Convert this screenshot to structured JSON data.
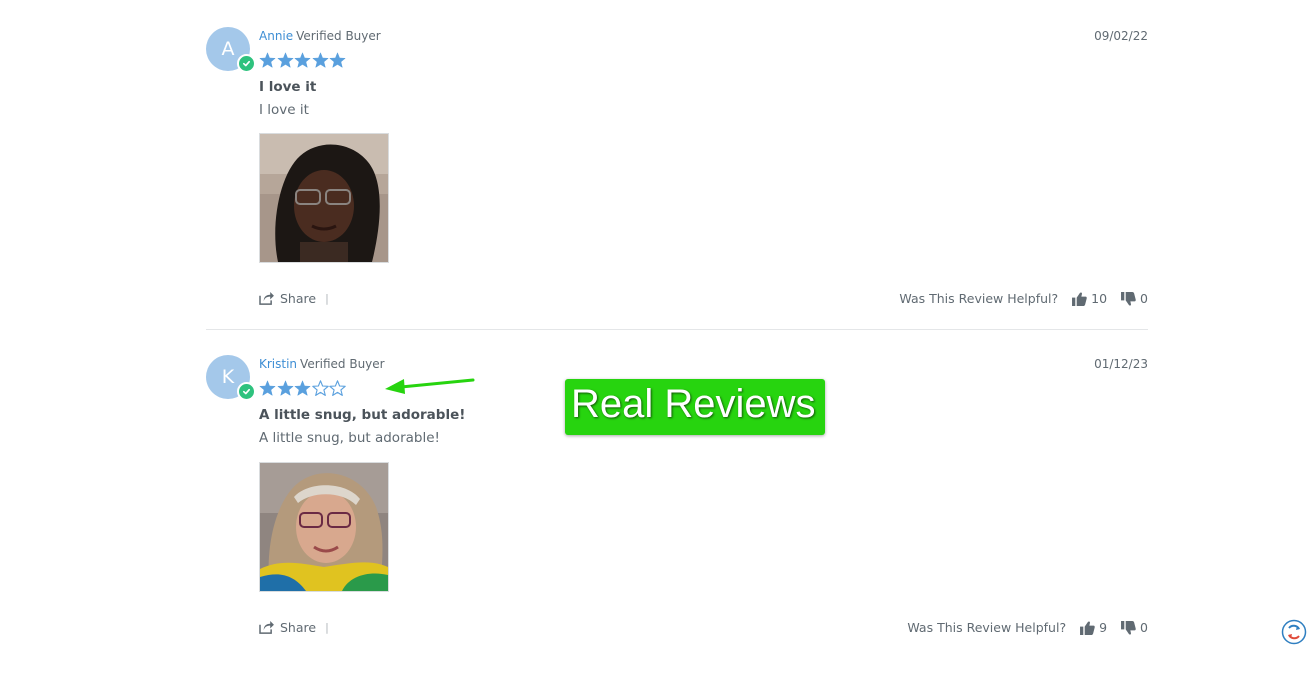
{
  "colors": {
    "star": "#5aa0de",
    "name": "#3e8ed4",
    "avatar_bg": "#a4c8ea",
    "verified_badge": "#2ec27e",
    "callout_bg": "#27d40f",
    "arrow": "#27d40f"
  },
  "reviews": [
    {
      "avatar_letter": "A",
      "name": "Annie",
      "verified_label": "Verified Buyer",
      "date": "09/02/22",
      "rating": 5,
      "max_rating": 5,
      "title": "I love it",
      "body": "I love it",
      "share_label": "Share",
      "share_separator": "|",
      "helpful_label": "Was This Review Helpful?",
      "thumbs_up_count": "10",
      "thumbs_down_count": "0"
    },
    {
      "avatar_letter": "K",
      "name": "Kristin",
      "verified_label": "Verified Buyer",
      "date": "01/12/23",
      "rating": 3,
      "max_rating": 5,
      "title": "A little snug, but adorable!",
      "body": "A little snug, but adorable!",
      "share_label": "Share",
      "share_separator": "|",
      "helpful_label": "Was This Review Helpful?",
      "thumbs_up_count": "9",
      "thumbs_down_count": "0"
    }
  ],
  "callout": {
    "text": "Real Reviews"
  }
}
